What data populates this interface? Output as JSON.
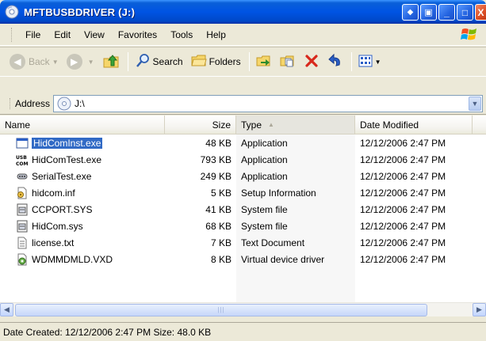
{
  "window": {
    "title": "MFTBUSBDRIVER (J:)",
    "buttons": {
      "back_to_parent": "◂▸",
      "minimize": "_",
      "maximize": "□",
      "close": "X"
    }
  },
  "menu": [
    "File",
    "Edit",
    "View",
    "Favorites",
    "Tools",
    "Help"
  ],
  "toolbar": {
    "back_label": "Back",
    "search_label": "Search",
    "folders_label": "Folders"
  },
  "address": {
    "label": "Address",
    "value": "J:\\"
  },
  "columns": {
    "name": "Name",
    "size": "Size",
    "type": "Type",
    "date": "Date Modified"
  },
  "files": [
    {
      "name": "HidComInst.exe",
      "size": "48 KB",
      "type": "Application",
      "date": "12/12/2006 2:47 PM",
      "icon": "exe-window-icon",
      "selected": true
    },
    {
      "name": "HidComTest.exe",
      "size": "793 KB",
      "type": "Application",
      "date": "12/12/2006 2:47 PM",
      "icon": "usb-com-icon",
      "selected": false
    },
    {
      "name": "SerialTest.exe",
      "size": "249 KB",
      "type": "Application",
      "date": "12/12/2006 2:47 PM",
      "icon": "serial-cable-icon",
      "selected": false
    },
    {
      "name": "hidcom.inf",
      "size": "5 KB",
      "type": "Setup Information",
      "date": "12/12/2006 2:47 PM",
      "icon": "setup-info-icon",
      "selected": false
    },
    {
      "name": "CCPORT.SYS",
      "size": "41 KB",
      "type": "System file",
      "date": "12/12/2006 2:47 PM",
      "icon": "system-file-icon",
      "selected": false
    },
    {
      "name": "HidCom.sys",
      "size": "68 KB",
      "type": "System file",
      "date": "12/12/2006 2:47 PM",
      "icon": "system-file-icon",
      "selected": false
    },
    {
      "name": "license.txt",
      "size": "7 KB",
      "type": "Text Document",
      "date": "12/12/2006 2:47 PM",
      "icon": "text-document-icon",
      "selected": false
    },
    {
      "name": "WDMMDMLD.VXD",
      "size": "8 KB",
      "type": "Virtual device driver",
      "date": "12/12/2006 2:47 PM",
      "icon": "vxd-driver-icon",
      "selected": false
    }
  ],
  "status": {
    "text": "Date Created: 12/12/2006 2:47 PM Size: 48.0 KB"
  },
  "colors": {
    "titlebar": "#0054e3",
    "selection": "#316ac5",
    "chrome": "#ece9d8"
  }
}
